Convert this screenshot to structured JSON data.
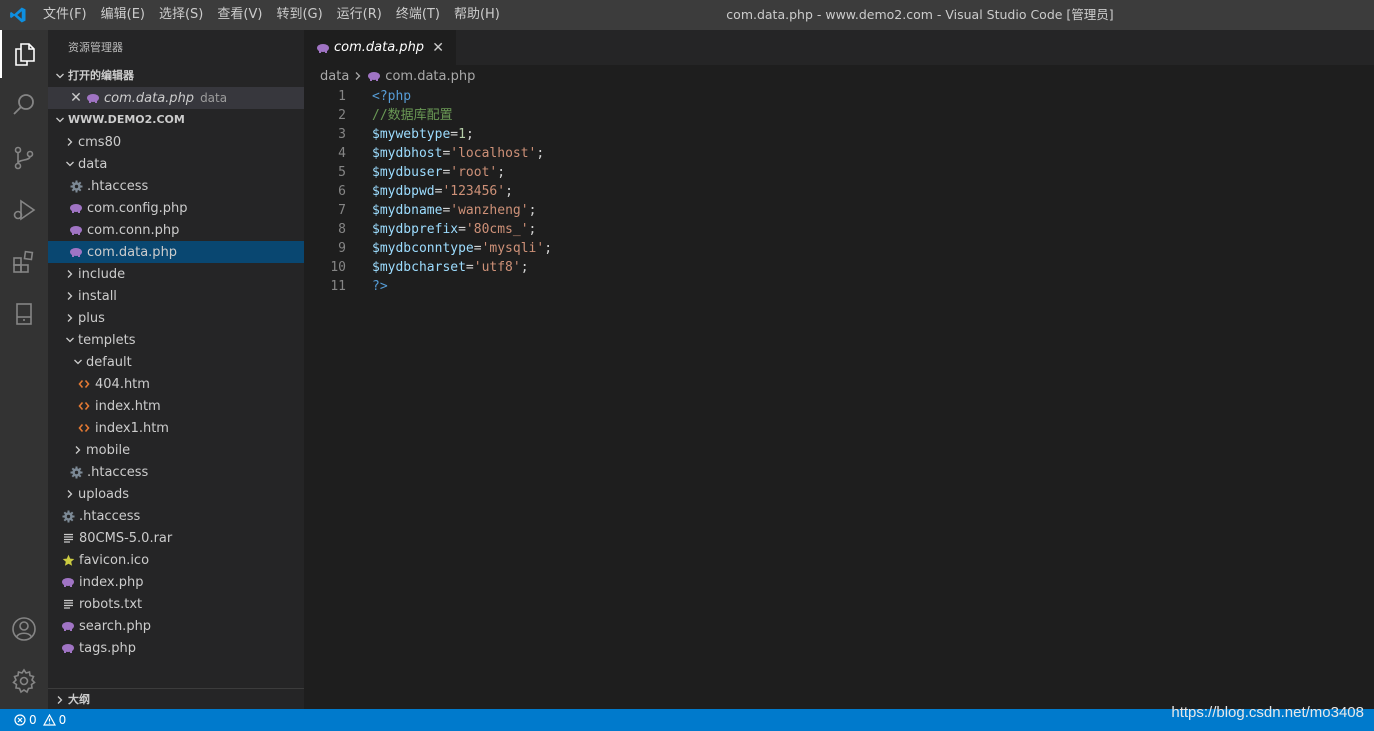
{
  "menu": [
    "文件(F)",
    "编辑(E)",
    "选择(S)",
    "查看(V)",
    "转到(G)",
    "运行(R)",
    "终端(T)",
    "帮助(H)"
  ],
  "window_title": "com.data.php - www.demo2.com - Visual Studio Code [管理员]",
  "sidebar": {
    "title": "资源管理器",
    "open_editors_header": "打开的编辑器",
    "open_editor": {
      "name": "com.data.php",
      "desc": "data"
    },
    "workspace_header": "WWW.DEMO2.COM",
    "tree": [
      {
        "label": "cms80",
        "type": "folder",
        "expanded": false,
        "depth": 0
      },
      {
        "label": "data",
        "type": "folder",
        "expanded": true,
        "depth": 0
      },
      {
        "label": ".htaccess",
        "type": "gear",
        "depth": 1
      },
      {
        "label": "com.config.php",
        "type": "php",
        "depth": 1
      },
      {
        "label": "com.conn.php",
        "type": "php",
        "depth": 1
      },
      {
        "label": "com.data.php",
        "type": "php",
        "depth": 1,
        "selected": true
      },
      {
        "label": "include",
        "type": "folder",
        "expanded": false,
        "depth": 0
      },
      {
        "label": "install",
        "type": "folder",
        "expanded": false,
        "depth": 0
      },
      {
        "label": "plus",
        "type": "folder",
        "expanded": false,
        "depth": 0
      },
      {
        "label": "templets",
        "type": "folder",
        "expanded": true,
        "depth": 0
      },
      {
        "label": "default",
        "type": "folder",
        "expanded": true,
        "depth": 1
      },
      {
        "label": "404.htm",
        "type": "html",
        "depth": 2
      },
      {
        "label": "index.htm",
        "type": "html",
        "depth": 2
      },
      {
        "label": "index1.htm",
        "type": "html",
        "depth": 2
      },
      {
        "label": "mobile",
        "type": "folder",
        "expanded": false,
        "depth": 1
      },
      {
        "label": ".htaccess",
        "type": "gear",
        "depth": 1
      },
      {
        "label": "uploads",
        "type": "folder",
        "expanded": false,
        "depth": 0
      },
      {
        "label": ".htaccess",
        "type": "gear",
        "depth": 0
      },
      {
        "label": "80CMS-5.0.rar",
        "type": "text",
        "depth": 0
      },
      {
        "label": "favicon.ico",
        "type": "star",
        "depth": 0
      },
      {
        "label": "index.php",
        "type": "php",
        "depth": 0
      },
      {
        "label": "robots.txt",
        "type": "text",
        "depth": 0
      },
      {
        "label": "search.php",
        "type": "php",
        "depth": 0
      },
      {
        "label": "tags.php",
        "type": "php",
        "depth": 0
      }
    ],
    "outline_header": "大纲"
  },
  "editor": {
    "tab_label": "com.data.php",
    "breadcrumb": [
      "data",
      "com.data.php"
    ],
    "lines": [
      [
        {
          "t": "<?php",
          "c": "tag"
        }
      ],
      [
        {
          "t": "//数据库配置",
          "c": "comment"
        }
      ],
      [
        {
          "t": "$mywebtype",
          "c": "var"
        },
        {
          "t": "=",
          "c": "op"
        },
        {
          "t": "1",
          "c": "num"
        },
        {
          "t": ";",
          "c": "op"
        }
      ],
      [
        {
          "t": "$mydbhost",
          "c": "var"
        },
        {
          "t": "=",
          "c": "op"
        },
        {
          "t": "'localhost'",
          "c": "str"
        },
        {
          "t": ";",
          "c": "op"
        }
      ],
      [
        {
          "t": "$mydbuser",
          "c": "var"
        },
        {
          "t": "=",
          "c": "op"
        },
        {
          "t": "'root'",
          "c": "str"
        },
        {
          "t": ";",
          "c": "op"
        }
      ],
      [
        {
          "t": "$mydbpwd",
          "c": "var"
        },
        {
          "t": "=",
          "c": "op"
        },
        {
          "t": "'123456'",
          "c": "str"
        },
        {
          "t": ";",
          "c": "op"
        }
      ],
      [
        {
          "t": "$mydbname",
          "c": "var"
        },
        {
          "t": "=",
          "c": "op"
        },
        {
          "t": "'wanzheng'",
          "c": "str"
        },
        {
          "t": ";",
          "c": "op"
        }
      ],
      [
        {
          "t": "$mydbprefix",
          "c": "var"
        },
        {
          "t": "=",
          "c": "op"
        },
        {
          "t": "'80cms_'",
          "c": "str"
        },
        {
          "t": ";",
          "c": "op"
        }
      ],
      [
        {
          "t": "$mydbconntype",
          "c": "var"
        },
        {
          "t": "=",
          "c": "op"
        },
        {
          "t": "'mysqli'",
          "c": "str"
        },
        {
          "t": ";",
          "c": "op"
        }
      ],
      [
        {
          "t": "$mydbcharset",
          "c": "var"
        },
        {
          "t": "=",
          "c": "op"
        },
        {
          "t": "'utf8'",
          "c": "str"
        },
        {
          "t": ";",
          "c": "op"
        }
      ],
      [
        {
          "t": "?>",
          "c": "tag"
        }
      ]
    ]
  },
  "status": {
    "errors": "0",
    "warnings": "0"
  },
  "watermark": "https://blog.csdn.net/mo3408",
  "colors": {
    "statusbar": "#007acc",
    "selected_row": "#094771",
    "php_icon": "#a074c4",
    "html_icon": "#e37933",
    "star_icon": "#cbcb41"
  }
}
